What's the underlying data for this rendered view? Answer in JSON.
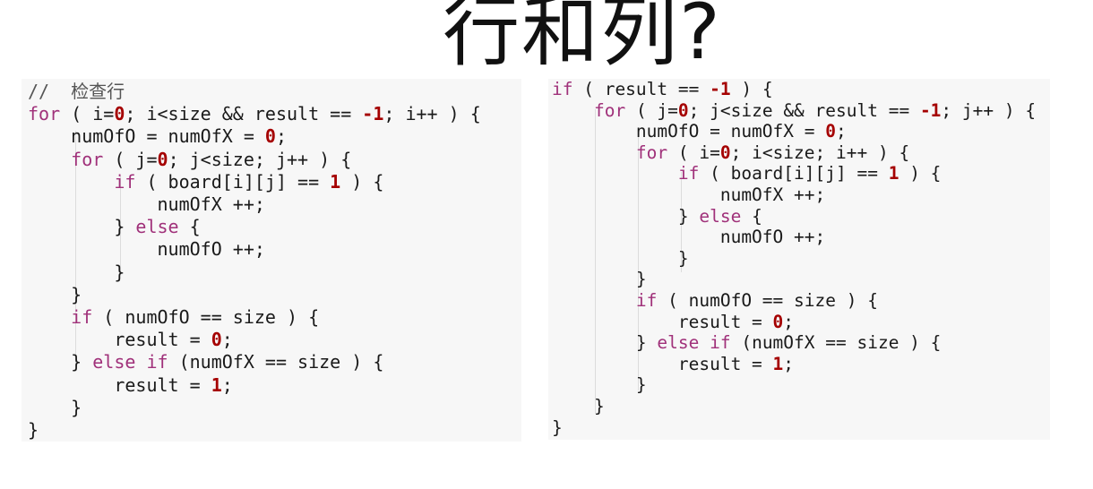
{
  "title": "行和列?",
  "left_code": {
    "lines": [
      [
        [
          "cm",
          "//  检查行"
        ]
      ],
      [
        [
          "kw",
          "for"
        ],
        [
          "t",
          " ( i="
        ],
        [
          "num",
          "0"
        ],
        [
          "t",
          "; i<size && result == "
        ],
        [
          "num",
          "-1"
        ],
        [
          "t",
          "; i++ ) {"
        ]
      ],
      [
        [
          "t",
          "    numOfO = numOfX = "
        ],
        [
          "num",
          "0"
        ],
        [
          "t",
          ";"
        ]
      ],
      [
        [
          "t",
          "    "
        ],
        [
          "kw",
          "for"
        ],
        [
          "t",
          " ( j="
        ],
        [
          "num",
          "0"
        ],
        [
          "t",
          "; j<size; j++ ) {"
        ]
      ],
      [
        [
          "t",
          "        "
        ],
        [
          "kw",
          "if"
        ],
        [
          "t",
          " ( board[i][j] == "
        ],
        [
          "num",
          "1"
        ],
        [
          "t",
          " ) {"
        ]
      ],
      [
        [
          "t",
          "            numOfX ++;"
        ]
      ],
      [
        [
          "t",
          "        } "
        ],
        [
          "kw",
          "else"
        ],
        [
          "t",
          " {"
        ]
      ],
      [
        [
          "t",
          "            numOfO ++;"
        ]
      ],
      [
        [
          "t",
          "        }"
        ]
      ],
      [
        [
          "t",
          "    }"
        ]
      ],
      [
        [
          "t",
          "    "
        ],
        [
          "kw",
          "if"
        ],
        [
          "t",
          " ( numOfO == size ) {"
        ]
      ],
      [
        [
          "t",
          "        result = "
        ],
        [
          "num",
          "0"
        ],
        [
          "t",
          ";"
        ]
      ],
      [
        [
          "t",
          "    } "
        ],
        [
          "kw",
          "else if"
        ],
        [
          "t",
          " (numOfX == size ) {"
        ]
      ],
      [
        [
          "t",
          "        result = "
        ],
        [
          "num",
          "1"
        ],
        [
          "t",
          ";"
        ]
      ],
      [
        [
          "t",
          "    }"
        ]
      ],
      [
        [
          "t",
          "}"
        ]
      ]
    ]
  },
  "right_code": {
    "lines": [
      [
        [
          "kw",
          "if"
        ],
        [
          "t",
          " ( result == "
        ],
        [
          "num",
          "-1"
        ],
        [
          "t",
          " ) {"
        ]
      ],
      [
        [
          "t",
          "    "
        ],
        [
          "kw",
          "for"
        ],
        [
          "t",
          " ( j="
        ],
        [
          "num",
          "0"
        ],
        [
          "t",
          "; j<size && result == "
        ],
        [
          "num",
          "-1"
        ],
        [
          "t",
          "; j++ ) {"
        ]
      ],
      [
        [
          "t",
          "        numOfO = numOfX = "
        ],
        [
          "num",
          "0"
        ],
        [
          "t",
          ";"
        ]
      ],
      [
        [
          "t",
          "        "
        ],
        [
          "kw",
          "for"
        ],
        [
          "t",
          " ( i="
        ],
        [
          "num",
          "0"
        ],
        [
          "t",
          "; i<size; i++ ) {"
        ]
      ],
      [
        [
          "t",
          "            "
        ],
        [
          "kw",
          "if"
        ],
        [
          "t",
          " ( board[i][j] == "
        ],
        [
          "num",
          "1"
        ],
        [
          "t",
          " ) {"
        ]
      ],
      [
        [
          "t",
          "                numOfX ++;"
        ]
      ],
      [
        [
          "t",
          "            } "
        ],
        [
          "kw",
          "else"
        ],
        [
          "t",
          " {"
        ]
      ],
      [
        [
          "t",
          "                numOfO ++;"
        ]
      ],
      [
        [
          "t",
          "            }"
        ]
      ],
      [
        [
          "t",
          "        }"
        ]
      ],
      [
        [
          "t",
          "        "
        ],
        [
          "kw",
          "if"
        ],
        [
          "t",
          " ( numOfO == size ) {"
        ]
      ],
      [
        [
          "t",
          "            result = "
        ],
        [
          "num",
          "0"
        ],
        [
          "t",
          ";"
        ]
      ],
      [
        [
          "t",
          "        } "
        ],
        [
          "kw",
          "else if"
        ],
        [
          "t",
          " (numOfX == size ) {"
        ]
      ],
      [
        [
          "t",
          "            result = "
        ],
        [
          "num",
          "1"
        ],
        [
          "t",
          ";"
        ]
      ],
      [
        [
          "t",
          "        }"
        ]
      ],
      [
        [
          "t",
          "    }"
        ]
      ],
      [
        [
          "t",
          "}"
        ]
      ]
    ]
  },
  "colors": {
    "background": "#ffffff",
    "panel": "#f7f7f7",
    "keyword": "#a0317a",
    "number": "#a50000",
    "text": "#1a1a1a"
  }
}
